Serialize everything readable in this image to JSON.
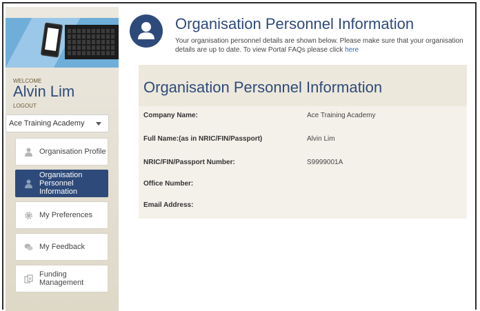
{
  "sidebar": {
    "welcome": "WELCOME",
    "user_name": "Alvin Lim",
    "logout": "LOGOUT",
    "organisation_select": "Ace Training Academy",
    "items": [
      {
        "label": "Organisation Profile",
        "icon": "person-icon"
      },
      {
        "label": "Organisation Personnel Information",
        "icon": "person-icon"
      },
      {
        "label": "My Preferences",
        "icon": "gear-icon"
      },
      {
        "label": "My Feedback",
        "icon": "chat-bubbles-icon"
      },
      {
        "label": "Funding Management",
        "icon": "funding-icon"
      }
    ]
  },
  "header": {
    "title": "Organisation Personnel Information",
    "intro": "Your organisation personnel details are shown below. Please make sure that your organisation details are up to date. To view Portal FAQs please click ",
    "faq_link": "here",
    "icon": "user-circle-icon"
  },
  "panel": {
    "title": "Organisation Personnel Information",
    "fields": [
      {
        "label": "Company Name:",
        "value": "Ace Training Academy"
      },
      {
        "label": "Full Name:(as in NRIC/FIN/Passport)",
        "value": "Alvin Lim"
      },
      {
        "label": "NRIC/FIN/Passport Number:",
        "value": "S9999001A"
      },
      {
        "label": "Office Number:",
        "value": ""
      },
      {
        "label": "Email Address:",
        "value": ""
      }
    ]
  },
  "colors": {
    "brand": "#2e4a7a",
    "sidebar": "#e6e1d4",
    "link": "#2a6bb3"
  }
}
